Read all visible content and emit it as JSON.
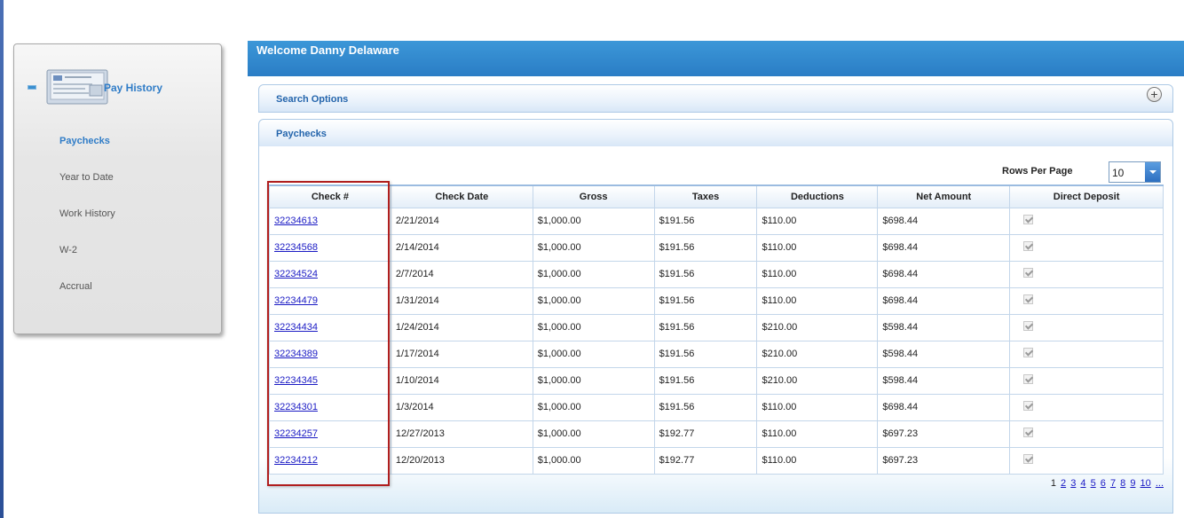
{
  "colors": {
    "accent": "#2f7cc7",
    "banner": "#3c97d8",
    "highlight": "#b01e1e",
    "link": "#1a1ac4"
  },
  "sidebar": {
    "section_title": "Pay History",
    "items": [
      {
        "label": "Paychecks",
        "active": true
      },
      {
        "label": "Year to Date",
        "active": false
      },
      {
        "label": "Work History",
        "active": false
      },
      {
        "label": "W-2",
        "active": false
      },
      {
        "label": "Accrual",
        "active": false
      }
    ]
  },
  "header": {
    "title": "Welcome Danny Delaware"
  },
  "search_panel": {
    "label": "Search Options",
    "icon": "plus-icon"
  },
  "paychecks_panel": {
    "label": "Paychecks",
    "rows_per_page_label": "Rows Per Page",
    "rows_per_page_value": "10",
    "columns": [
      "Check #",
      "Check Date",
      "Gross",
      "Taxes",
      "Deductions",
      "Net Amount",
      "Direct Deposit"
    ],
    "rows": [
      {
        "check": "32234613",
        "date": "2/21/2014",
        "gross": "$1,000.00",
        "taxes": "$191.56",
        "deductions": "$110.00",
        "net": "$698.44",
        "direct_deposit": true
      },
      {
        "check": "32234568",
        "date": "2/14/2014",
        "gross": "$1,000.00",
        "taxes": "$191.56",
        "deductions": "$110.00",
        "net": "$698.44",
        "direct_deposit": true
      },
      {
        "check": "32234524",
        "date": "2/7/2014",
        "gross": "$1,000.00",
        "taxes": "$191.56",
        "deductions": "$110.00",
        "net": "$698.44",
        "direct_deposit": true
      },
      {
        "check": "32234479",
        "date": "1/31/2014",
        "gross": "$1,000.00",
        "taxes": "$191.56",
        "deductions": "$110.00",
        "net": "$698.44",
        "direct_deposit": true
      },
      {
        "check": "32234434",
        "date": "1/24/2014",
        "gross": "$1,000.00",
        "taxes": "$191.56",
        "deductions": "$210.00",
        "net": "$598.44",
        "direct_deposit": true
      },
      {
        "check": "32234389",
        "date": "1/17/2014",
        "gross": "$1,000.00",
        "taxes": "$191.56",
        "deductions": "$210.00",
        "net": "$598.44",
        "direct_deposit": true
      },
      {
        "check": "32234345",
        "date": "1/10/2014",
        "gross": "$1,000.00",
        "taxes": "$191.56",
        "deductions": "$210.00",
        "net": "$598.44",
        "direct_deposit": true
      },
      {
        "check": "32234301",
        "date": "1/3/2014",
        "gross": "$1,000.00",
        "taxes": "$191.56",
        "deductions": "$110.00",
        "net": "$698.44",
        "direct_deposit": true
      },
      {
        "check": "32234257",
        "date": "12/27/2013",
        "gross": "$1,000.00",
        "taxes": "$192.77",
        "deductions": "$110.00",
        "net": "$697.23",
        "direct_deposit": true
      },
      {
        "check": "32234212",
        "date": "12/20/2013",
        "gross": "$1,000.00",
        "taxes": "$192.77",
        "deductions": "$110.00",
        "net": "$697.23",
        "direct_deposit": true
      }
    ],
    "pager": {
      "current": "1",
      "pages": [
        "2",
        "3",
        "4",
        "5",
        "6",
        "7",
        "8",
        "9",
        "10"
      ],
      "more": "..."
    }
  }
}
